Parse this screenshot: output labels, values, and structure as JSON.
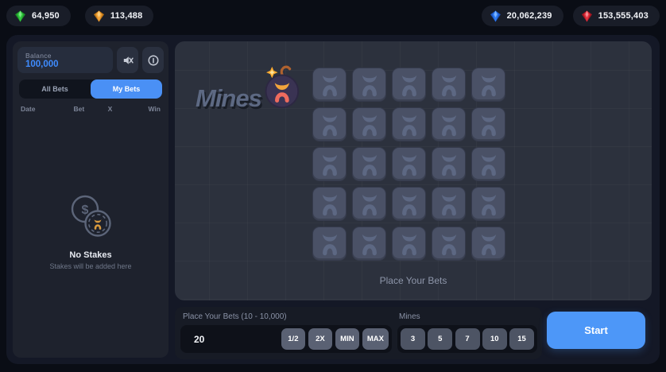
{
  "topbar": {
    "currencies": [
      {
        "icon": "green-gem-icon",
        "value": "64,950",
        "color": "#30c73d"
      },
      {
        "icon": "gold-gem-icon",
        "value": "113,488",
        "color": "#f0a23a"
      },
      {
        "icon": "blue-gem-icon",
        "value": "20,062,239",
        "color": "#2e7bf0"
      },
      {
        "icon": "red-gem-icon",
        "value": "153,555,403",
        "color": "#e0313f"
      }
    ]
  },
  "sidebar": {
    "balance_label": "Balance",
    "balance_value": "100,000",
    "icons": {
      "mute": "muted-speaker-icon",
      "info": "info-icon"
    },
    "tabs": [
      {
        "label": "All Bets",
        "active": false
      },
      {
        "label": "My Bets",
        "active": true
      }
    ],
    "table_headers": [
      "Date",
      "Bet",
      "X",
      "Win"
    ],
    "empty_state": {
      "icon": "coin-chip-icon",
      "title": "No Stakes",
      "subtitle": "Stakes will be added here"
    }
  },
  "game": {
    "logo_text": "Mines",
    "logo_icon": "bomb-icon",
    "board": {
      "rows": 5,
      "cols": 5,
      "tile_icon": "mine-tile-icon"
    },
    "status_text": "Place Your Bets"
  },
  "controls": {
    "bet_label": "Place Your Bets (10 - 10,000)",
    "bet_value": "20",
    "bet_buttons": [
      "1/2",
      "2X",
      "MIN",
      "MAX"
    ],
    "mines_label": "Mines",
    "mines_options": [
      "3",
      "5",
      "7",
      "10",
      "15"
    ],
    "start_label": "Start"
  },
  "colors": {
    "accent_blue": "#4d97f8",
    "balance_blue": "#3f8cff",
    "panel_dark": "#141826",
    "tile": "#4a5166"
  }
}
